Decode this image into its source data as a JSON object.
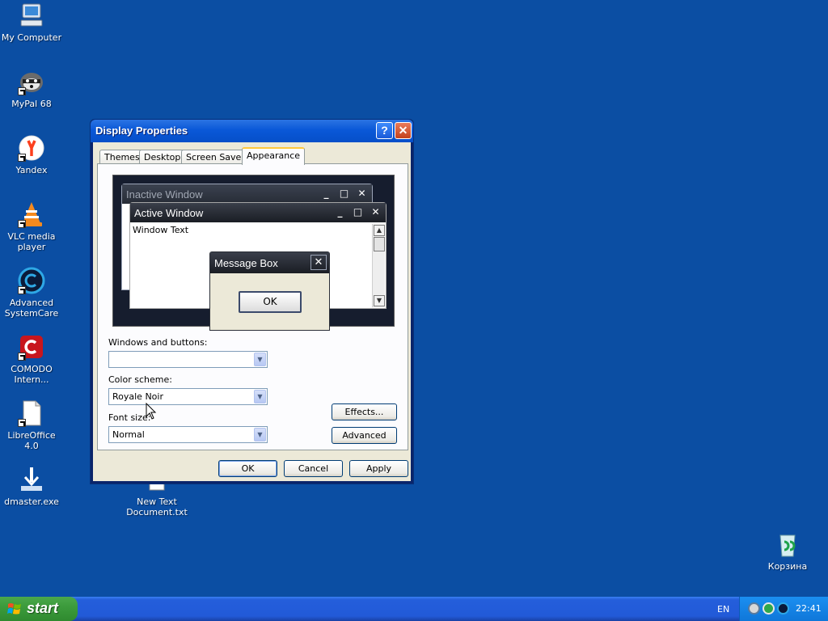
{
  "desktop": {
    "icons": [
      {
        "label": "My Computer",
        "icon": "computer-icon"
      },
      {
        "label": "MyPal 68",
        "icon": "mypal-icon"
      },
      {
        "label": "Yandex",
        "icon": "yandex-icon"
      },
      {
        "label": "VLC media player",
        "icon": "vlc-icon"
      },
      {
        "label": "Advanced SystemCare",
        "icon": "systemcare-icon"
      },
      {
        "label": "COMODO Intern...",
        "icon": "comodo-icon"
      },
      {
        "label": "LibreOffice 4.0",
        "icon": "libreoffice-icon"
      },
      {
        "label": "dmaster.exe",
        "icon": "download-icon"
      },
      {
        "label": "New Text Document.txt",
        "icon": "text-file-icon"
      },
      {
        "label": "Корзина",
        "icon": "recycle-bin-icon"
      }
    ]
  },
  "dialog": {
    "title": "Display Properties",
    "help_glyph": "?",
    "close_glyph": "✕",
    "tabs": [
      "Themes",
      "Desktop",
      "Screen Saver",
      "Appearance"
    ],
    "active_tab": "Appearance",
    "preview": {
      "inactive_title": "Inactive Window",
      "active_title": "Active Window",
      "window_text": "Window Text",
      "message_box_title": "Message Box",
      "message_box_ok": "OK"
    },
    "windows_and_buttons": {
      "label": "Windows and buttons:",
      "value": ""
    },
    "color_scheme": {
      "label": "Color scheme:",
      "value": "Royale Noir"
    },
    "font_size": {
      "label": "Font size:",
      "value": "Normal"
    },
    "effects_label": "Effects...",
    "advanced_label": "Advanced",
    "ok_label": "OK",
    "cancel_label": "Cancel",
    "apply_label": "Apply"
  },
  "taskbar": {
    "start_label": "start",
    "language": "EN",
    "clock": "22:41"
  },
  "colors": {
    "desktop_bg": "#0b4ea3",
    "taskbar": "#245edb",
    "start_button": "#3c9b3c",
    "tray": "#0f77d9"
  }
}
